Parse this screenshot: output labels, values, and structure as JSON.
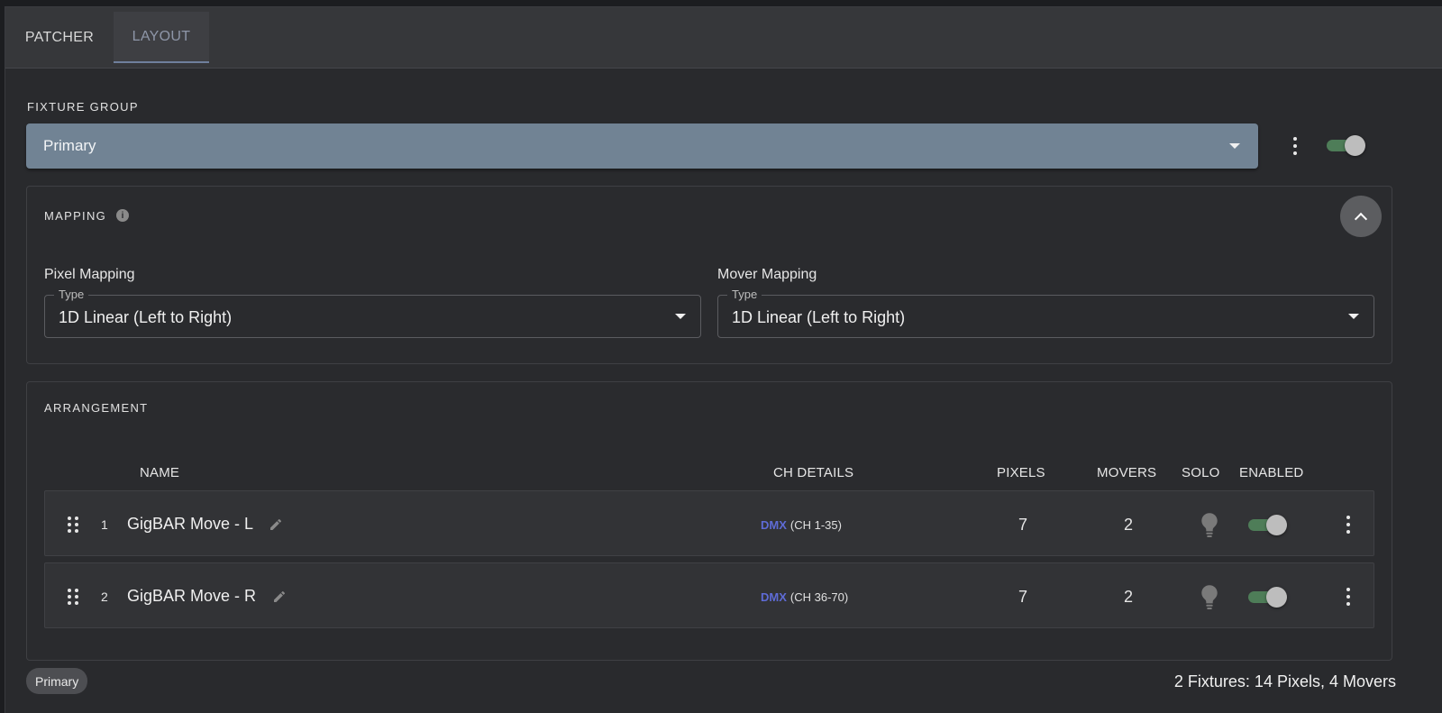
{
  "tabs": [
    {
      "label": "PATCHER",
      "active": false
    },
    {
      "label": "LAYOUT",
      "active": true
    }
  ],
  "fixture_group": {
    "label": "FIXTURE GROUP",
    "selected": "Primary",
    "enabled": true
  },
  "mapping": {
    "title": "MAPPING",
    "info_icon": "info-icon",
    "pixel": {
      "title": "Pixel Mapping",
      "legend": "Type",
      "value": "1D Linear (Left to Right)"
    },
    "mover": {
      "title": "Mover Mapping",
      "legend": "Type",
      "value": "1D Linear (Left to Right)"
    }
  },
  "arrangement": {
    "title": "ARRANGEMENT",
    "headers": {
      "name": "NAME",
      "ch_details": "CH DETAILS",
      "pixels": "PIXELS",
      "movers": "MOVERS",
      "solo": "SOLO",
      "enabled": "ENABLED"
    },
    "rows": [
      {
        "index": "1",
        "name": "GigBAR Move - L",
        "protocol": "DMX",
        "channels": "(CH 1-35)",
        "pixels": "7",
        "movers": "2",
        "solo": false,
        "enabled": true
      },
      {
        "index": "2",
        "name": "GigBAR Move - R",
        "protocol": "DMX",
        "channels": "(CH 36-70)",
        "pixels": "7",
        "movers": "2",
        "solo": false,
        "enabled": true
      }
    ]
  },
  "footer": {
    "chip": "Primary",
    "summary": "2 Fixtures: 14 Pixels, 4 Movers"
  },
  "colors": {
    "accent_tab": "#6f7f9c",
    "select_bg": "#718394",
    "toggle_on": "#4e7d58",
    "dmx_label": "#5e6bd6"
  }
}
